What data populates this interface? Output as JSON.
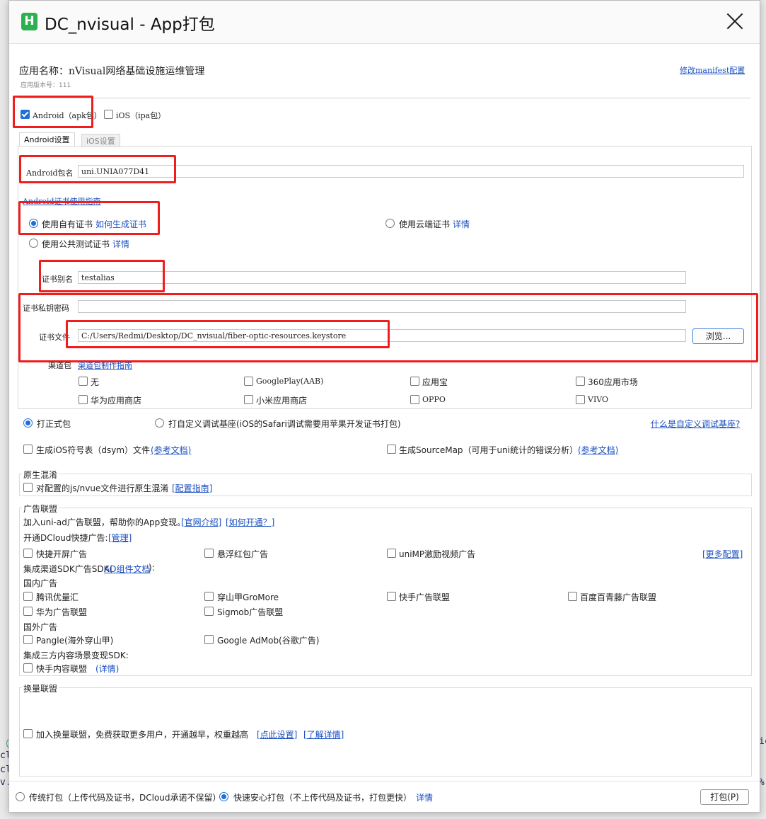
{
  "background_text": [
    "（存包",
    "cl",
    "cl",
    "v.",
    "ic",
    "%"
  ],
  "window": {
    "logo_letter": "H",
    "title": "DC_nvisual - App打包"
  },
  "app": {
    "name_label": "应用名称：nVisual网络基础设施运维管理",
    "version_label": "应用版本号：111",
    "manifest_link": "修改manifest配置"
  },
  "platforms": {
    "android": "Android（apk包）",
    "ios": "iOS（ipa包）"
  },
  "tabs": [
    "Android设置",
    "iOS设置"
  ],
  "android": {
    "package_label": "Android包名",
    "package_value": "uni.UNIA077D41",
    "cert_guide": "Android证书使用指南",
    "use_own_cert": "使用自有证书",
    "how_generate": "如何生成证书",
    "use_cloud_cert": "使用云端证书",
    "use_public_cert": "使用公共测试证书",
    "detail": "详情",
    "alias_label": "证书别名",
    "alias_value": "testalias",
    "password_label": "证书私钥密码",
    "password_value": "",
    "file_label": "证书文件",
    "file_value": "C:/Users/Redmi/Desktop/DC_nvisual/fiber-optic-resources.keystore",
    "browse": "浏览...",
    "channel_label": "渠道包",
    "channel_link": "渠道包制作指南",
    "channels": [
      "无",
      "GooglePlay(AAB)",
      "应用宝",
      "360应用市场",
      "华为应用商店",
      "小米应用商店",
      "OPPO",
      "VIVO"
    ]
  },
  "build_type": {
    "formal": "打正式包",
    "custom_base": "打自定义调试基座(iOS的Safari调试需要用苹果开发证书打包)",
    "what_link": "什么是自定义调试基座?"
  },
  "symbols": {
    "ios_dsym": "生成iOS符号表（dsym）文件",
    "ref1": "(参考文档)",
    "sourcemap": "生成SourceMap（可用于uni统计的错误分析）",
    "ref2": "(参考文档)"
  },
  "obfuscation": {
    "title": "原生混淆",
    "option": "对配置的js/nvue文件进行原生混淆",
    "link": "[配置指南]"
  },
  "ads": {
    "title": "广告联盟",
    "intro": "加入uni-ad广告联盟，帮助你的App变现。",
    "official": "[官网介绍]",
    "how_open": "[如何开通？]",
    "quick_label": "开通DCloud快捷广告:",
    "manage": "[管理]",
    "quick": [
      "快捷开屏广告",
      "悬浮红包广告",
      "uniMP激励视频广告"
    ],
    "more_config": "[更多配置]",
    "channel_sdk_label": "集成渠道SDK广告SDK(",
    "channel_sdk_link": "AD组件文档",
    "channel_sdk_end": "):",
    "domestic": "国内广告",
    "domestic_items": [
      "腾讯优量汇",
      "穿山甲GroMore",
      "快手广告联盟",
      "百度百青藤广告联盟",
      "华为广告联盟",
      "Sigmob广告联盟"
    ],
    "foreign": "国外广告",
    "foreign_items": [
      "Pangle(海外穿山甲)",
      "Google AdMob(谷歌广告)"
    ],
    "content_label": "集成三方内容场景变现SDK:",
    "content_item": "快手内容联盟",
    "content_detail": "(详情)"
  },
  "exchange": {
    "title": "换量联盟",
    "option": "加入换量联盟，免费获取更多用户，开通越早，权重越高",
    "settings": "[点此设置]",
    "learn": "[了解详情]"
  },
  "footer": {
    "traditional": "传统打包（上传代码及证书，DCloud承诺不保留）",
    "fast": "快速安心打包（不上传代码及证书，打包更快）",
    "detail": "详情",
    "pack": "打包(P)"
  },
  "colors": {
    "accent": "#1e6fd9",
    "annotation": "#f01d1d",
    "logo": "#2db04f",
    "link": "#1a4fc0"
  }
}
